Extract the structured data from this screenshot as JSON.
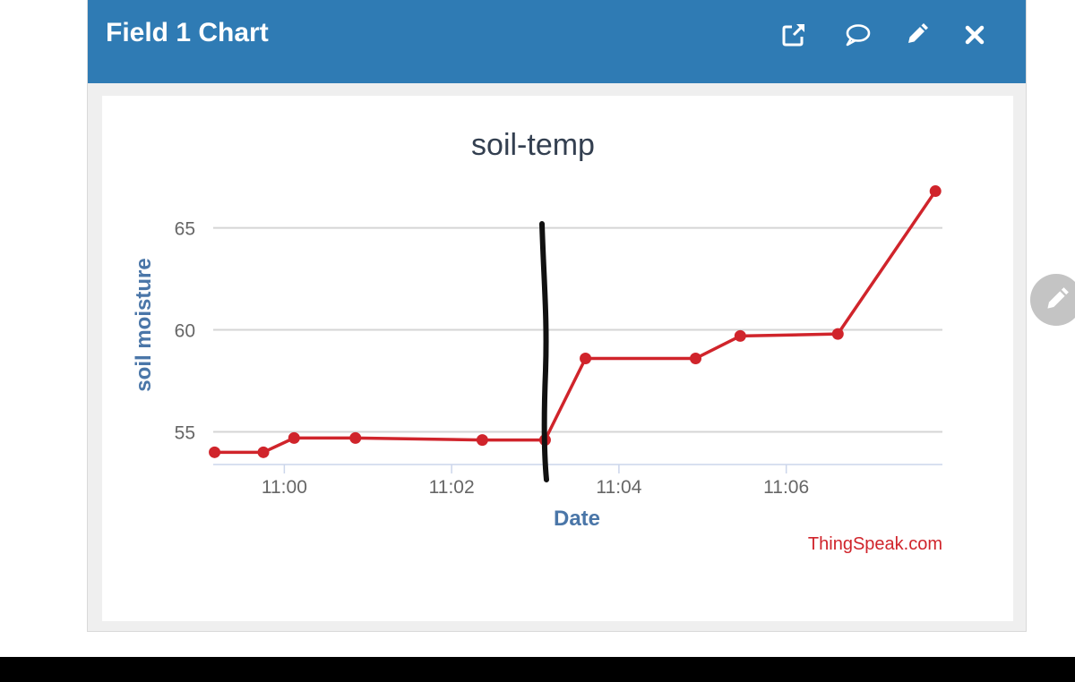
{
  "widget": {
    "title": "Field 1 Chart",
    "buttons": [
      {
        "name": "open-external-icon"
      },
      {
        "name": "comment-icon"
      },
      {
        "name": "pencil-icon"
      },
      {
        "name": "close-icon"
      }
    ],
    "header_color": "#2f7bb4"
  },
  "credit": "ThingSpeak.com",
  "chart_data": {
    "type": "line",
    "title": "soil-temp",
    "xlabel": "Date",
    "ylabel": "soil moisture",
    "x_tick_labels": [
      "11:00",
      "11:02",
      "11:04",
      "11:06"
    ],
    "x_tick_minutes": [
      0,
      2,
      4,
      6
    ],
    "y_ticks": [
      55,
      60,
      65
    ],
    "xlim": [
      "10:59:09",
      "11:07:52"
    ],
    "ylim": [
      53.4,
      67
    ],
    "grid": true,
    "legend": "none",
    "series": [
      {
        "color": "#d0242b",
        "points": [
          {
            "x": "10:59:10",
            "y": 54
          },
          {
            "x": "10:59:45",
            "y": 54
          },
          {
            "x": "11:00:07",
            "y": 54.7
          },
          {
            "x": "11:00:51",
            "y": 54.7
          },
          {
            "x": "11:02:22",
            "y": 54.6
          },
          {
            "x": "11:03:07",
            "y": 54.6
          },
          {
            "x": "11:03:36",
            "y": 58.6
          },
          {
            "x": "11:04:55",
            "y": 58.6
          },
          {
            "x": "11:05:27",
            "y": 59.7
          },
          {
            "x": "11:06:37",
            "y": 59.8
          },
          {
            "x": "11:07:47",
            "y": 66.8
          }
        ]
      }
    ]
  }
}
